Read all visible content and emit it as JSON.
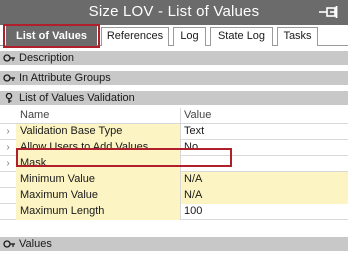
{
  "window": {
    "title": "Size LOV - List of Values"
  },
  "tabs": [
    {
      "label": "List of Values"
    },
    {
      "label": "References"
    },
    {
      "label": "Log"
    },
    {
      "label": "State Log"
    },
    {
      "label": "Tasks"
    }
  ],
  "sections": {
    "description": "Description",
    "attribute_groups": "In Attribute Groups",
    "validation": "List of Values Validation",
    "values": "Values"
  },
  "grid": {
    "headers": {
      "name": "Name",
      "value": "Value"
    },
    "rows": [
      {
        "name": "Validation Base Type",
        "value": "Text"
      },
      {
        "name": "Allow Users to Add Values",
        "value": "No"
      },
      {
        "name": "Mask",
        "value": ""
      },
      {
        "name": "Minimum Value",
        "value": "N/A"
      },
      {
        "name": "Maximum Value",
        "value": "N/A"
      },
      {
        "name": "Maximum Length",
        "value": "100"
      }
    ]
  },
  "colors": {
    "titlebar": "#6b6b6b",
    "section_header": "#c8c8c8",
    "row_fill": "#fcf4c2",
    "highlight": "#b0202c"
  },
  "icons": {
    "pin": "pin-icon",
    "collapsed_section": "key-collapsed-icon",
    "expanded_section": "key-expanded-icon",
    "row_expander": "chevron-right-icon"
  }
}
